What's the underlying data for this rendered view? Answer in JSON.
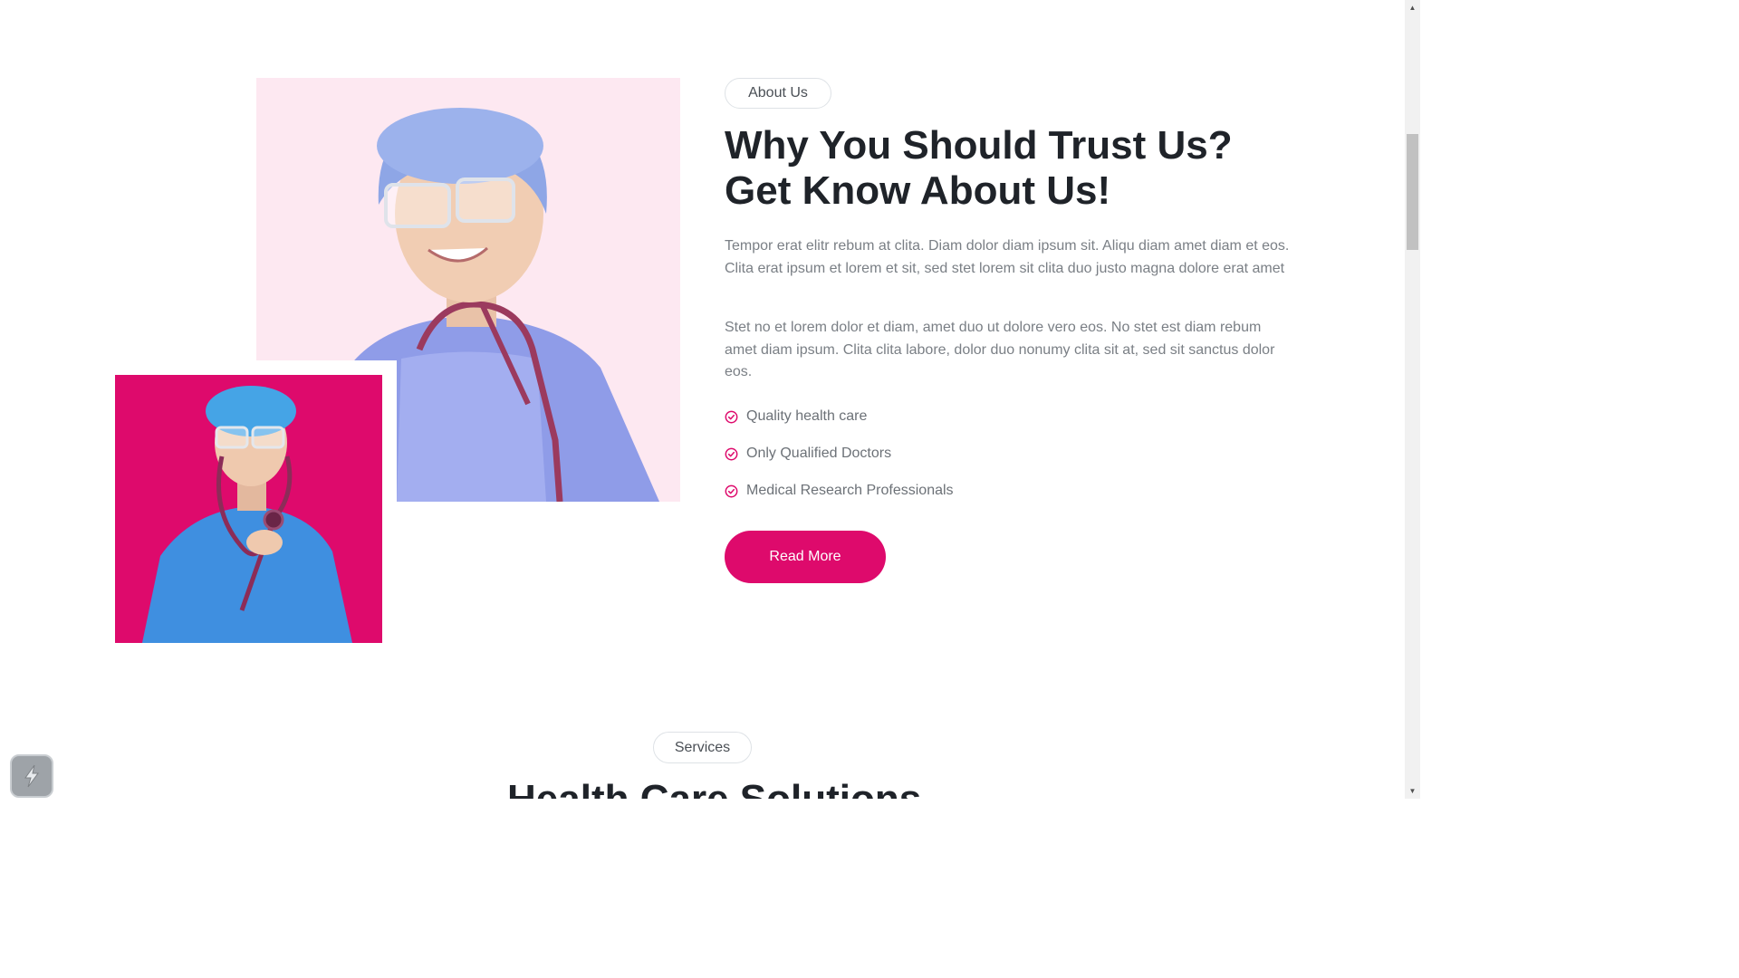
{
  "about": {
    "badge": "About Us",
    "heading": "Why You Should Trust Us? Get Know About Us!",
    "paragraph_1": "Tempor erat elitr rebum at clita. Diam dolor diam ipsum sit. Aliqu diam amet diam et eos. Clita erat ipsum et lorem et sit, sed stet lorem sit clita duo justo magna dolore erat amet",
    "paragraph_2": "Stet no et lorem dolor et diam, amet duo ut dolore vero eos. No stet est diam rebum amet diam ipsum. Clita clita labore, dolor duo nonumy clita sit at, sed sit sanctus dolor eos.",
    "features": [
      {
        "label": "Quality health care",
        "icon": "check-circle-icon"
      },
      {
        "label": "Only Qualified Doctors",
        "icon": "check-circle-icon"
      },
      {
        "label": "Medical Research Professionals",
        "icon": "check-circle-icon"
      }
    ],
    "button_label": "Read More"
  },
  "services": {
    "badge": "Services",
    "heading": "Health Care Solutions"
  },
  "colors": {
    "accent": "#de0a6c",
    "large_photo_bg": "#fde8f1",
    "heading": "#1f2329",
    "body_text": "#7a7f85"
  }
}
